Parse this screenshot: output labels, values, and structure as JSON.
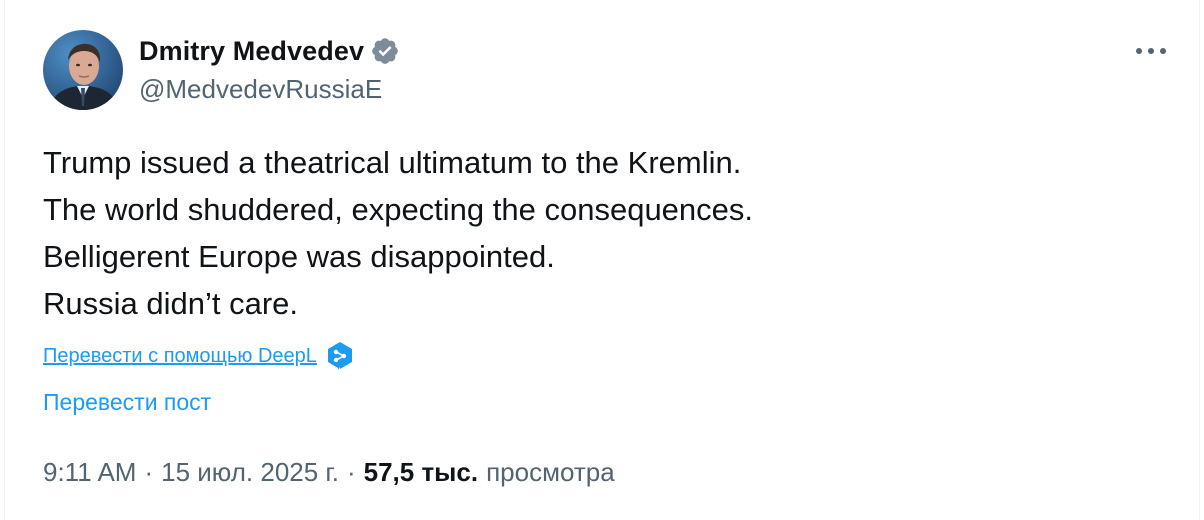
{
  "author": {
    "display_name": "Dmitry Medvedev",
    "handle": "@MedvedevRussiaE",
    "verified": true,
    "avatar_icon": "profile-photo"
  },
  "menu": {
    "icon": "more-horizontal-icon"
  },
  "tweet": {
    "lines": [
      "Trump issued a theatrical ultimatum to the Kremlin.",
      "The world shuddered, expecting the consequences.",
      "Belligerent Europe was disappointed.",
      "Russia didn’t care."
    ]
  },
  "translation": {
    "deepl_link": "Перевести с помощью DeepL",
    "deepl_icon": "deepl-logo-icon",
    "translate_post": "Перевести пост"
  },
  "meta": {
    "time": "9:11 AM",
    "separator": "·",
    "date": "15 июл. 2025 г.",
    "views_count": "57,5 тыс.",
    "views_label": "просмотра"
  },
  "colors": {
    "link": "#1d9bf0",
    "verified_badge": "#7d8c98",
    "secondary_text": "#536471",
    "primary_text": "#0f1419"
  }
}
